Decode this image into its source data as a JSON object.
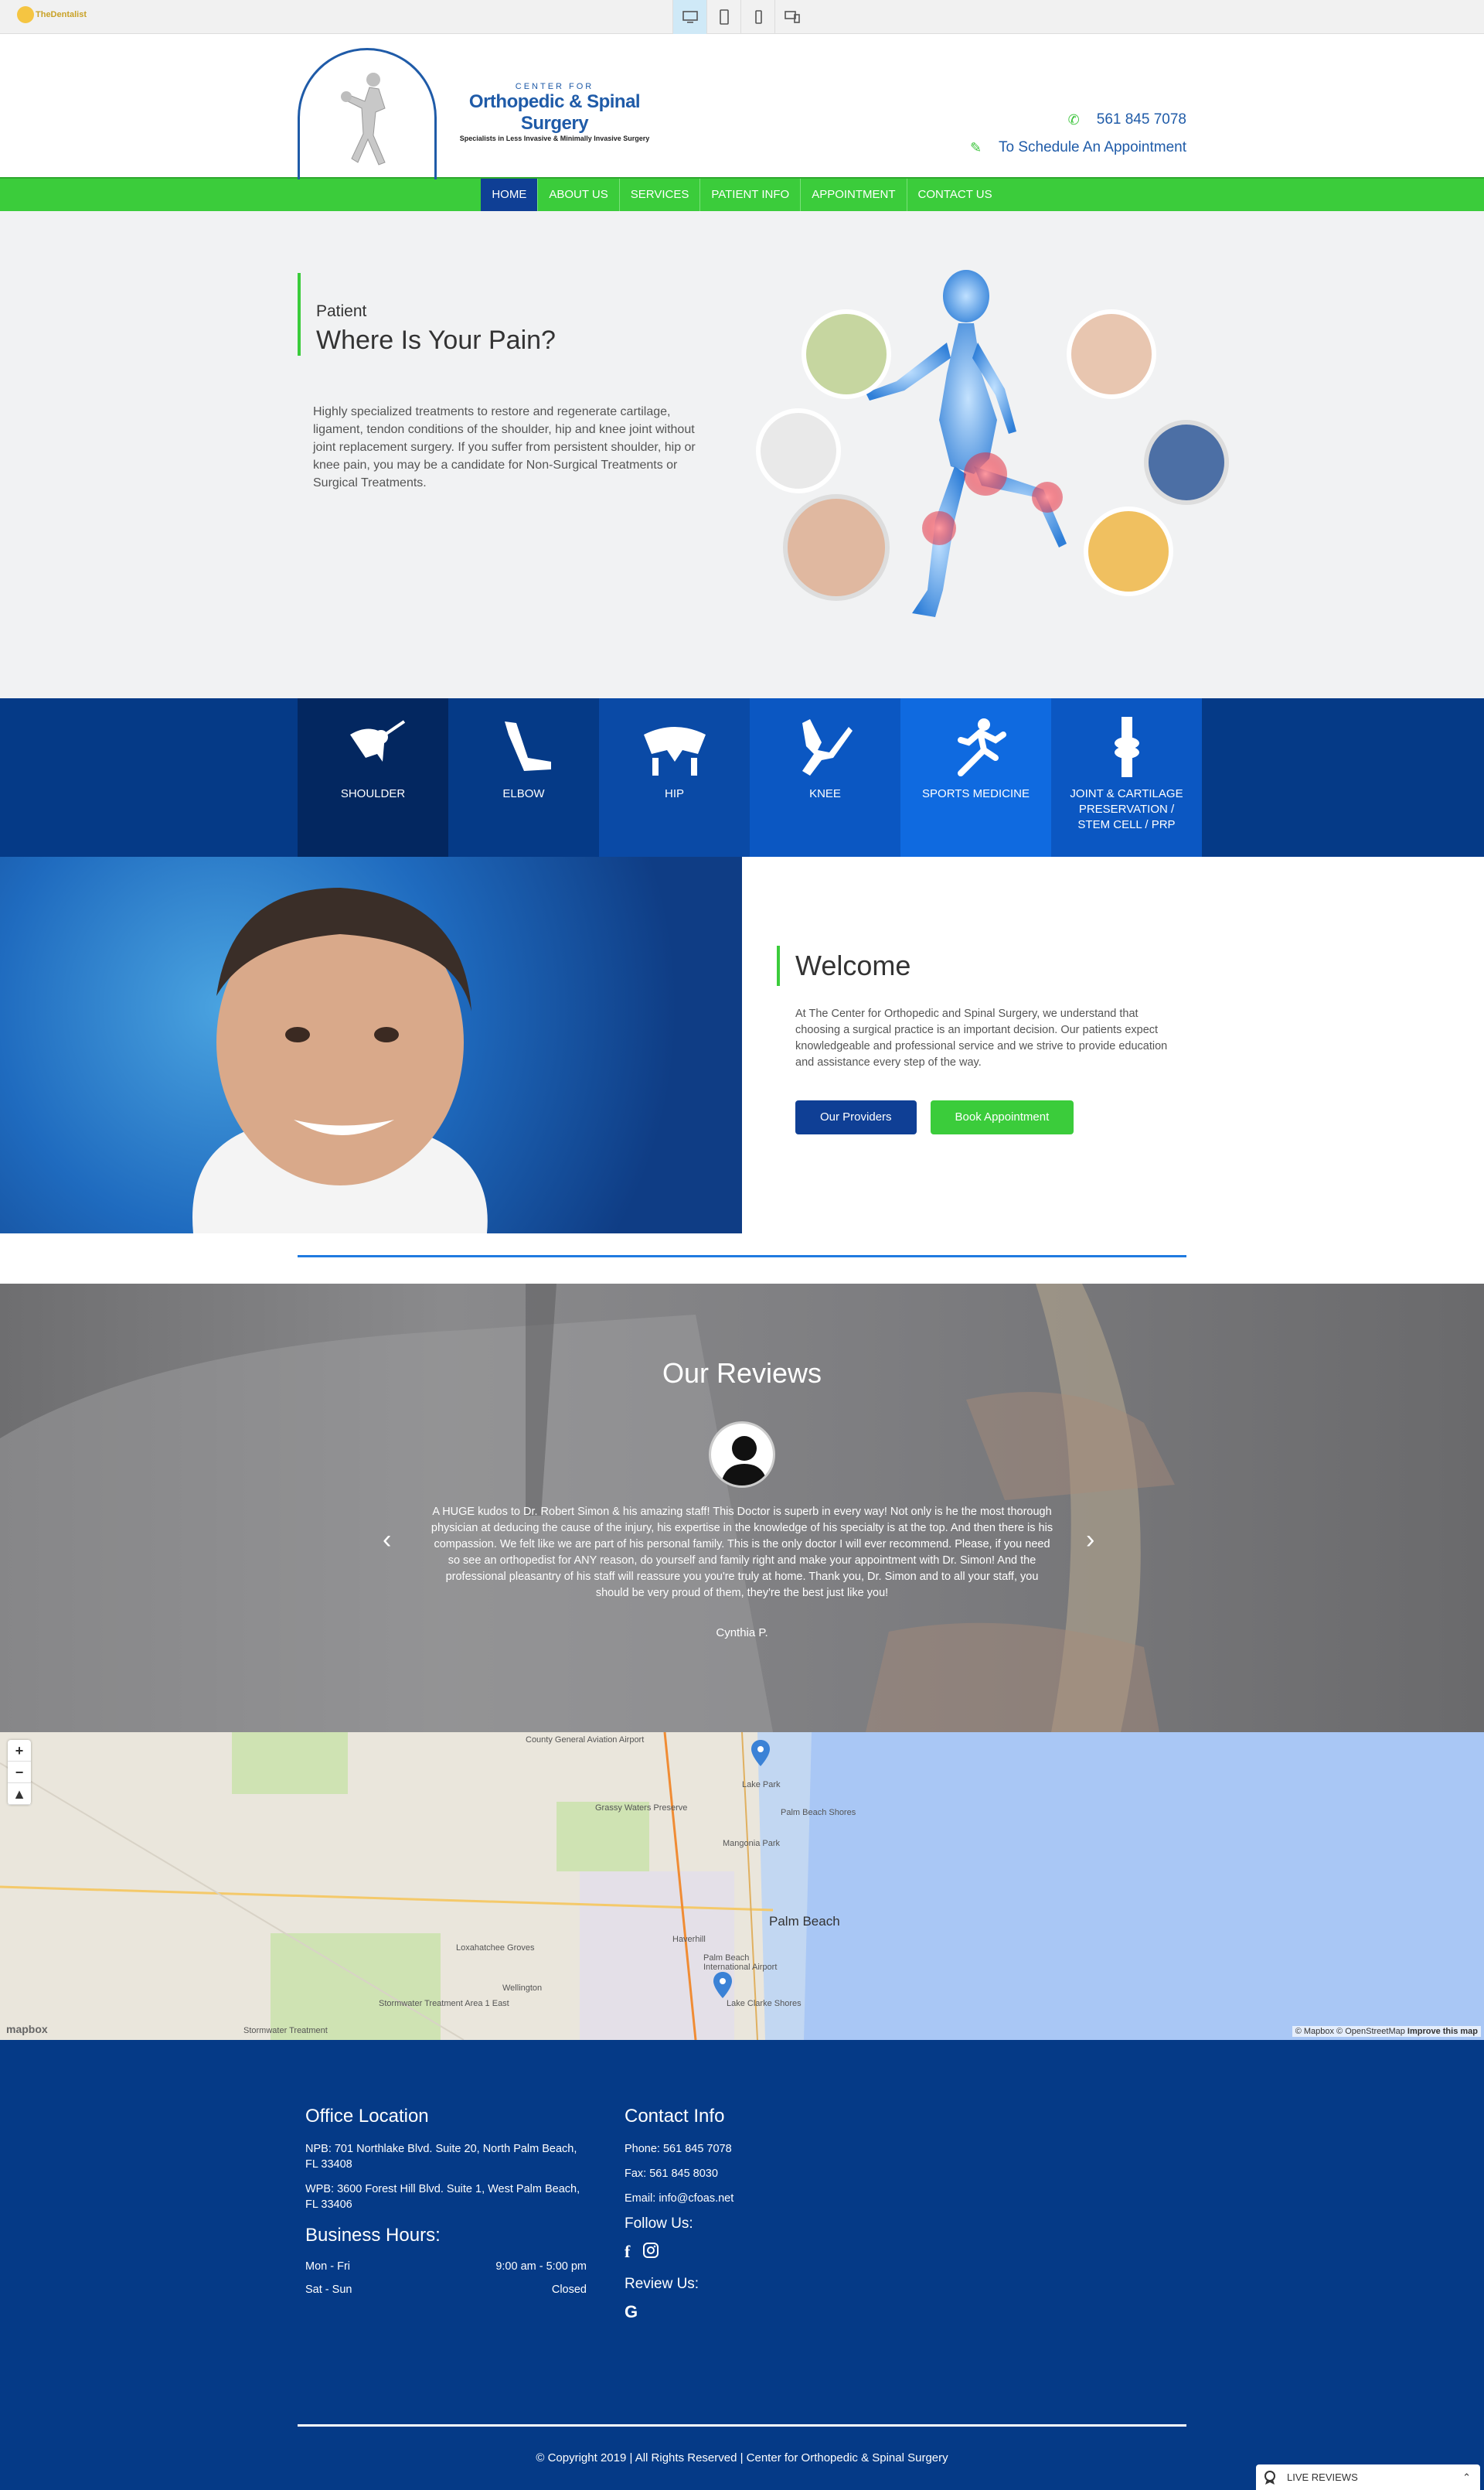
{
  "preview": {
    "logo_text": "TheDentalist",
    "devices": [
      "desktop-icon",
      "tablet-icon",
      "mobile-icon",
      "multi-device-icon"
    ]
  },
  "header": {
    "logo_small": "CENTER FOR",
    "logo_big": "Orthopedic & Spinal Surgery",
    "logo_tagline": "Specialists in Less Invasive & Minimally Invasive Surgery",
    "phone": "561 845 7078",
    "schedule": "To Schedule An Appointment"
  },
  "nav": {
    "items": [
      "HOME",
      "ABOUT US",
      "SERVICES",
      "PATIENT INFO",
      "APPOINTMENT",
      "CONTACT US"
    ],
    "active": "HOME"
  },
  "hero": {
    "kicker": "Patient",
    "title": "Where Is Your Pain?",
    "body": "Highly specialized treatments to restore and regenerate cartilage, ligament, tendon conditions of the shoulder, hip and knee joint without joint replacement surgery. If you suffer from persistent shoulder, hip or knee pain, you may be a candidate for Non-Surgical Treatments or Surgical Treatments."
  },
  "services": [
    {
      "label": "SHOULDER",
      "icon": "shoulder-icon"
    },
    {
      "label": "ELBOW",
      "icon": "elbow-icon"
    },
    {
      "label": "HIP",
      "icon": "hip-icon"
    },
    {
      "label": "KNEE",
      "icon": "knee-icon"
    },
    {
      "label": "SPORTS MEDICINE",
      "icon": "runner-icon"
    },
    {
      "label": "JOINT & CARTILAGE PRESERVATION / STEM CELL / PRP",
      "icon": "joint-icon"
    }
  ],
  "welcome": {
    "title": "Welcome",
    "body": "At The Center for Orthopedic and Spinal Surgery, we understand that choosing a surgical practice is an important decision. Our patients expect knowledgeable and professional service and we strive to provide education and assistance every step of the way.",
    "btn_providers": "Our Providers",
    "btn_book": "Book Appointment"
  },
  "reviews": {
    "title": "Our Reviews",
    "text": "A HUGE kudos to Dr. Robert Simon & his amazing staff! This Doctor is superb in every way! Not only is he the most thorough physician at deducing the cause of the injury, his expertise in the knowledge of his specialty is at the top. And then there is his compassion. We felt like we are part of his personal family. This is the only doctor I will ever recommend. Please, if you need so see an orthopedist for ANY reason, do yourself and family right and make your appointment with Dr. Simon! And the professional pleasantry of his staff will reassure you you're truly at home. Thank you, Dr. Simon and to all your staff, you should be very proud of them, they're the best just like you!",
    "author": "Cynthia P."
  },
  "map": {
    "labels": [
      "County General Aviation Airport",
      "Lake Park",
      "Palm Beach Shores",
      "Grassy Waters Preserve",
      "Mangonia Park",
      "Palm Beach",
      "Haverhill",
      "Palm Beach International Airport",
      "Lake Clarke Shores",
      "Loxahatchee Groves",
      "Wellington",
      "Stormwater Treatment Area 1 East",
      "Stormwater Treatment"
    ],
    "attribution": "© Mapbox © OpenStreetMap",
    "improve": "Improve this map",
    "logo": "mapbox"
  },
  "footer": {
    "office_title": "Office Location",
    "office_npb": "NPB: 701 Northlake Blvd. Suite 20, North Palm Beach, FL 33408",
    "office_wpb": "WPB: 3600 Forest Hill Blvd. Suite 1, West Palm Beach, FL 33406",
    "hours_title": "Business Hours:",
    "hours": [
      {
        "day": "Mon - Fri",
        "time": "9:00 am - 5:00 pm"
      },
      {
        "day": "Sat - Sun",
        "time": "Closed"
      }
    ],
    "contact_title": "Contact Info",
    "phone": "Phone: 561 845 7078",
    "fax": "Fax: 561 845 8030",
    "email": "Email: info@cfoas.net",
    "follow_title": "Follow Us:",
    "review_title": "Review Us:",
    "copyright": "© Copyright 2019 | All Rights Reserved | Center for Orthopedic & Spinal Surgery",
    "live_reviews": "LIVE REVIEWS"
  },
  "colors": {
    "brand_blue": "#053a87",
    "nav_green": "#3bcc3b",
    "active_blue": "#0f3f95"
  }
}
